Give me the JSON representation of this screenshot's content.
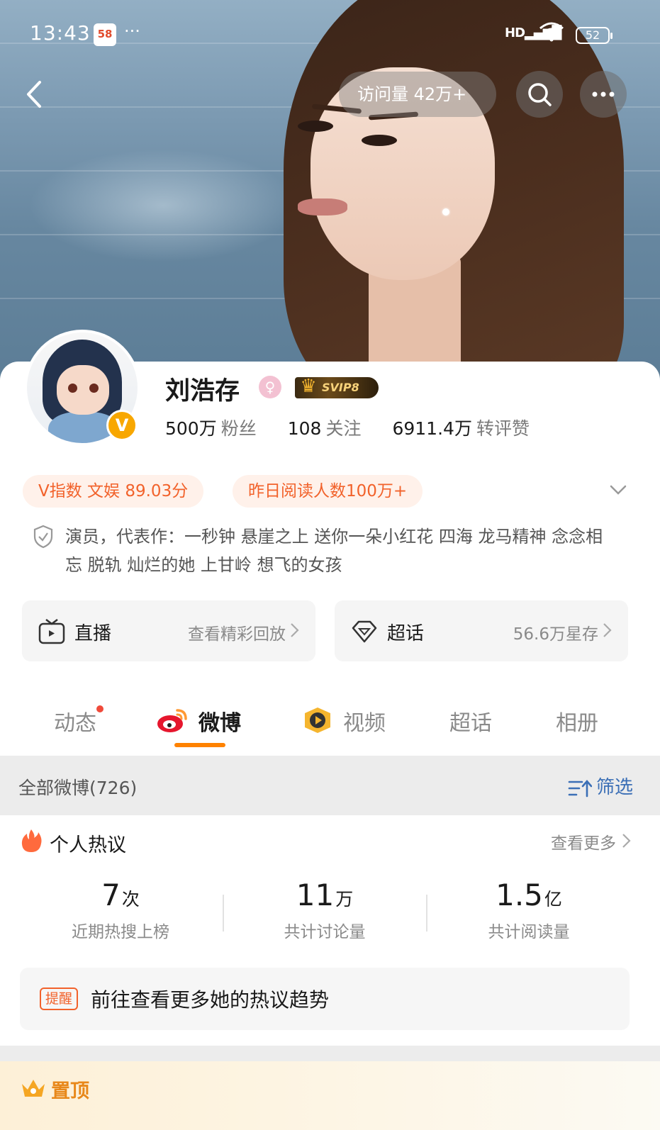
{
  "status_bar": {
    "time": "13:43",
    "app_badge": "58",
    "more": "···",
    "network": "HD",
    "battery": "52"
  },
  "header": {
    "visits": "访问量 42万+"
  },
  "profile": {
    "name": "刘浩存",
    "vip_label": "SVIP8",
    "verified_mark": "V",
    "stats": [
      {
        "num": "500万",
        "label": "粉丝"
      },
      {
        "num": "108",
        "label": "关注"
      },
      {
        "num": "6911.4万",
        "label": "转评赞"
      }
    ],
    "tags": [
      "V指数 文娱 89.03分",
      "昨日阅读人数100万+"
    ],
    "bio": "演员，代表作：一秒钟 悬崖之上 送你一朵小红花 四海 龙马精神 念念相忘 脱轨 灿烂的她 上甘岭 想飞的女孩"
  },
  "shortcuts": [
    {
      "title": "直播",
      "subtitle": "查看精彩回放"
    },
    {
      "title": "超话",
      "subtitle": "56.6万星存"
    }
  ],
  "tabs": [
    {
      "label": "动态"
    },
    {
      "label": "微博"
    },
    {
      "label": "视频"
    },
    {
      "label": "超话"
    },
    {
      "label": "相册"
    }
  ],
  "filter_bar": {
    "count": "全部微博(726)",
    "filter_label": "筛选"
  },
  "hot_topics": {
    "title": "个人热议",
    "more": "查看更多",
    "stats": [
      {
        "value": "7",
        "unit": "次",
        "caption": "近期热搜上榜"
      },
      {
        "value": "11",
        "unit": "万",
        "caption": "共计讨论量"
      },
      {
        "value": "1.5",
        "unit": "亿",
        "caption": "共计阅读量"
      }
    ],
    "reminder_badge": "提醒",
    "reminder_text": "前往查看更多她的热议趋势"
  },
  "pinned": {
    "label": "置顶"
  },
  "colors": {
    "accent_orange": "#ff8200",
    "tag_text": "#f2622b",
    "link_blue": "#3b6fb6",
    "pinned_gold": "#e8881a"
  }
}
